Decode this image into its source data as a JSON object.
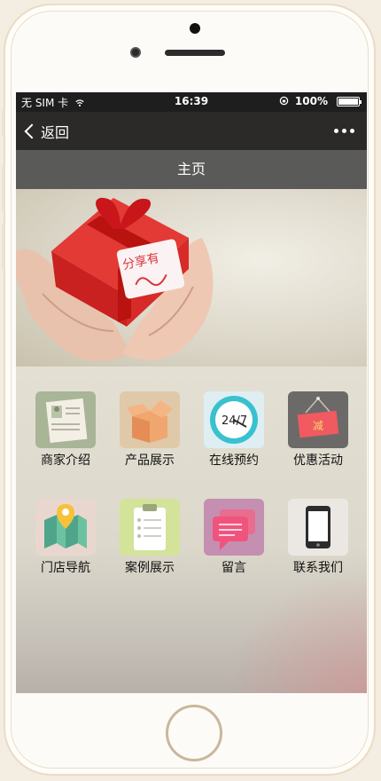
{
  "status": {
    "carrier": "无 SIM 卡",
    "time": "16:39",
    "battery": "100%"
  },
  "nav": {
    "back_label": "返回"
  },
  "page": {
    "title": "主页"
  },
  "banner": {
    "tag_text": "分享有礼",
    "slides": 2,
    "active_slide": 1
  },
  "menu": [
    {
      "label": "商家介绍",
      "icon": "profile-card-icon",
      "color": "#a8b597"
    },
    {
      "label": "产品展示",
      "icon": "box-icon",
      "color": "#e0c9a9"
    },
    {
      "label": "在线预约",
      "icon": "clock-24-7-icon",
      "color": "#dfeef2",
      "clock_text": "24/7"
    },
    {
      "label": "优惠活动",
      "icon": "discount-sign-icon",
      "color": "#6c6a68",
      "sign_text": "减"
    },
    {
      "label": "门店导航",
      "icon": "map-pin-icon",
      "color": "#e9d7cf"
    },
    {
      "label": "案例展示",
      "icon": "clipboard-icon",
      "color": "#d3e39a"
    },
    {
      "label": "留言",
      "icon": "chat-bubble-icon",
      "color": "#c58fb1"
    },
    {
      "label": "联系我们",
      "icon": "mobile-phone-icon",
      "color": "#ebe8e3"
    }
  ]
}
